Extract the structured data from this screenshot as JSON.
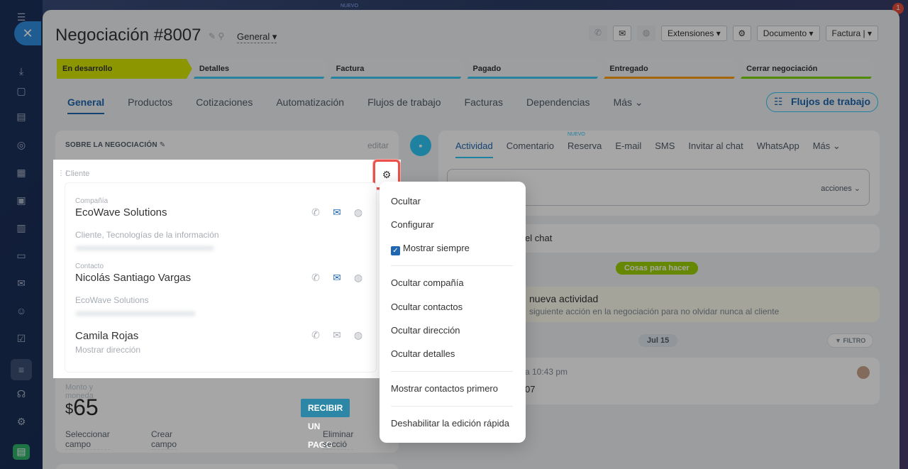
{
  "topstrip": {
    "nuevo": "NUEVO",
    "notif_count": "1"
  },
  "header": {
    "title": "Negociación #8007",
    "category": "General",
    "extensions_label": "Extensiones",
    "document_label": "Documento",
    "invoice_label": "Factura"
  },
  "stages": [
    {
      "label": "En desarrollo",
      "bg": "#d7e600",
      "bar": "#d7e600"
    },
    {
      "label": "Detalles",
      "bg": "#f1f3f5",
      "bar": "#3bc8f5"
    },
    {
      "label": "Factura",
      "bg": "#f1f3f5",
      "bar": "#3bc8f5"
    },
    {
      "label": "Pagado",
      "bg": "#f1f3f5",
      "bar": "#3bc8f5"
    },
    {
      "label": "Entregado",
      "bg": "#f1f3f5",
      "bar": "#ff9b00"
    },
    {
      "label": "Cerrar negociación",
      "bg": "#f1f3f5",
      "bar": "#7bd500"
    }
  ],
  "tabs": [
    "General",
    "Productos",
    "Cotizaciones",
    "Automatización",
    "Flujos de trabajo",
    "Facturas",
    "Dependencias",
    "Más"
  ],
  "tab_flujos": "Flujos de trabajo",
  "about": {
    "title": "SOBRE LA NEGOCIACIÓN",
    "edit": "editar"
  },
  "client": {
    "label": "Cliente",
    "company": {
      "type": "Compañía",
      "name": "EcoWave Solutions",
      "sub": "Cliente, Tecnologías de la información"
    },
    "contact": {
      "type": "Contacto",
      "name": "Nicolás Santiago Vargas",
      "sub": "EcoWave Solutions"
    },
    "contact2": {
      "name": "Camila Rojas",
      "sub": "Mostrar dirección"
    }
  },
  "money": {
    "label": "Monto y moneda",
    "currency": "$",
    "amount": "65",
    "pay_button": "RECIBIR UN PAGO"
  },
  "links": {
    "select": "Seleccionar campo",
    "create": "Crear campo",
    "delete": "Eliminar secció"
  },
  "activity": {
    "tabs": [
      "Actividad",
      "Comentario",
      "Reserva",
      "E-mail",
      "SMS",
      "Invitar al chat",
      "WhatsApp",
      "Más"
    ],
    "nuevo": "NUEVO",
    "actions": "acciones",
    "chat_line": "el chat",
    "todo_pill": "Cosas para hacer",
    "new_activity": "nueva actividad",
    "new_activity_sub": "siguiente acción en la negociación para no olvidar nunca al cliente",
    "date": "Jul 15",
    "filter": "FILTRO",
    "item_time": "a  10:43 pm",
    "item_text": "07"
  },
  "menu": {
    "items": [
      "Ocultar",
      "Configurar",
      "Mostrar siempre",
      "Ocultar compañía",
      "Ocultar contactos",
      "Ocultar dirección",
      "Ocultar detalles",
      "Mostrar contactos primero",
      "Deshabilitar la edición rápida"
    ]
  }
}
